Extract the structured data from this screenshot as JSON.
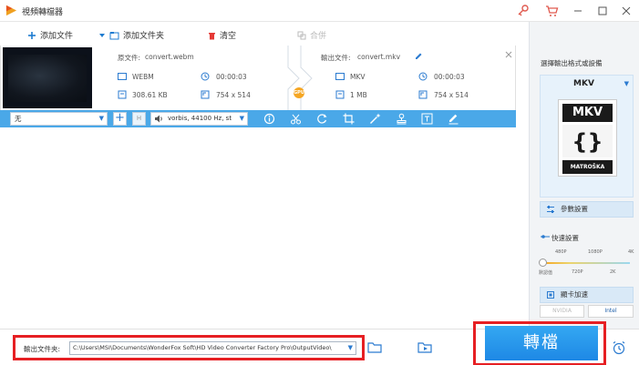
{
  "app": {
    "title": "視頻轉檔器"
  },
  "toolbar": {
    "add_file": "添加文件",
    "add_folder": "添加文件夹",
    "clear": "清空",
    "merge": "合併"
  },
  "file": {
    "source_label": "原文件:",
    "source_name": "convert.webm",
    "source_format": "WEBM",
    "source_duration": "00:00:03",
    "source_size": "308.61 KB",
    "source_resolution": "754 x 514",
    "output_label": "輸出文件:",
    "output_name": "convert.mkv",
    "output_format": "MKV",
    "output_duration": "00:00:03",
    "output_size": "1 MB",
    "output_resolution": "754 x 514",
    "gpu_badge": "GPU"
  },
  "edit_bar": {
    "subtitle_value": "无",
    "subtitle_mark": "H",
    "audio_value": "vorbis, 44100 Hz, st"
  },
  "right_panel": {
    "title": "選擇輸出格式或設備",
    "format": "MKV",
    "mkv_top": "MKV",
    "mkv_bottom": "MATROŠKA",
    "params_button": "參數設置",
    "speed_title": "快速設置",
    "speed_ticks_top": [
      "480P",
      "1080P",
      "4K"
    ],
    "speed_ticks_bottom": [
      "默認值",
      "720P",
      "2K"
    ],
    "gpu_button": "顯卡加速",
    "hw_nvidia": "NVIDIA",
    "hw_intel": "Intel"
  },
  "bottom": {
    "output_folder_label": "輸出文件夹:",
    "output_path": "C:\\Users\\MSI\\Documents\\WonderFox Soft\\HD Video Converter Factory Pro\\OutputVideo\\",
    "convert_button": "轉檔"
  },
  "colors": {
    "accent": "#4aa8e8",
    "convert": "#1e88e5",
    "highlight": "#e61f23"
  }
}
